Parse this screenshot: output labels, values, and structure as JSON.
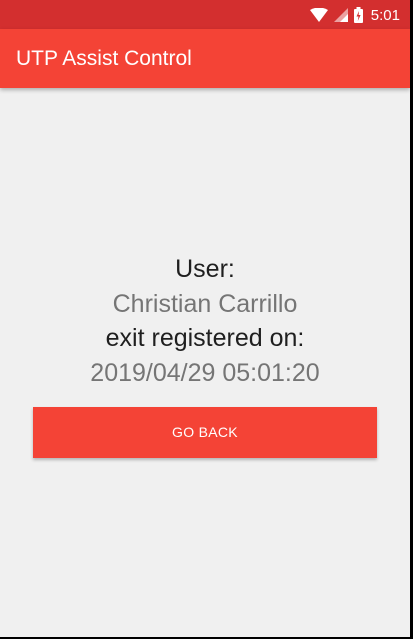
{
  "status_bar": {
    "time": "5:01",
    "icons": [
      "wifi-icon",
      "signal-icon",
      "battery-charging-icon"
    ],
    "color": "#d32f2f"
  },
  "app_bar": {
    "title": "UTP Assist Control",
    "color": "#f44336"
  },
  "main": {
    "user_label": "User:",
    "user_name": "Christian Carrillo",
    "exit_label": "exit registered on:",
    "timestamp": "2019/04/29 05:01:20",
    "go_back_label": "GO BACK"
  }
}
